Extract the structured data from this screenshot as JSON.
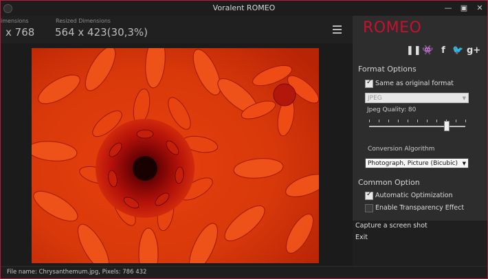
{
  "window": {
    "title": "Voralent ROMEO"
  },
  "header": {
    "original_label": "imensions",
    "original_value": "x 768",
    "resized_label": "Resized Dimensions",
    "resized_value": "564 x 423(30,3%)"
  },
  "panel": {
    "brand": "ROMEO",
    "social_icons": [
      "pause-icon",
      "space-invader-icon",
      "facebook-icon",
      "twitter-icon",
      "google-plus-icon"
    ],
    "social_glyphs": {
      "pause": "❚❚",
      "invader": "👾",
      "facebook": "f",
      "twitter": "🐦",
      "gplus": "g+"
    },
    "format_options": {
      "title": "Format Options",
      "same_as_original": {
        "label": "Same as original format",
        "checked": true
      },
      "format_select": {
        "value": "JPEG",
        "enabled": false
      },
      "quality_label": "Jpeg Quality: 80",
      "quality_value": 80,
      "conversion_label": "Conversion Algorithm",
      "conversion_select": {
        "value": "Photograph, Picture (Bicubic)"
      }
    },
    "common_option": {
      "title": "Common Option",
      "auto_optimization": {
        "label": "Automatic Optimization",
        "checked": true
      },
      "transparency": {
        "label": "Enable Transparency Effect",
        "checked": false
      }
    }
  },
  "menu": {
    "capture": "Capture a screen shot",
    "exit": "Exit"
  },
  "status": {
    "text": "File name: Chrysanthemum.jpg, Pixels: 786 432"
  },
  "colors": {
    "accent": "#c8102e",
    "border": "#b21f3a",
    "panel_bg": "#2d2d2d"
  }
}
